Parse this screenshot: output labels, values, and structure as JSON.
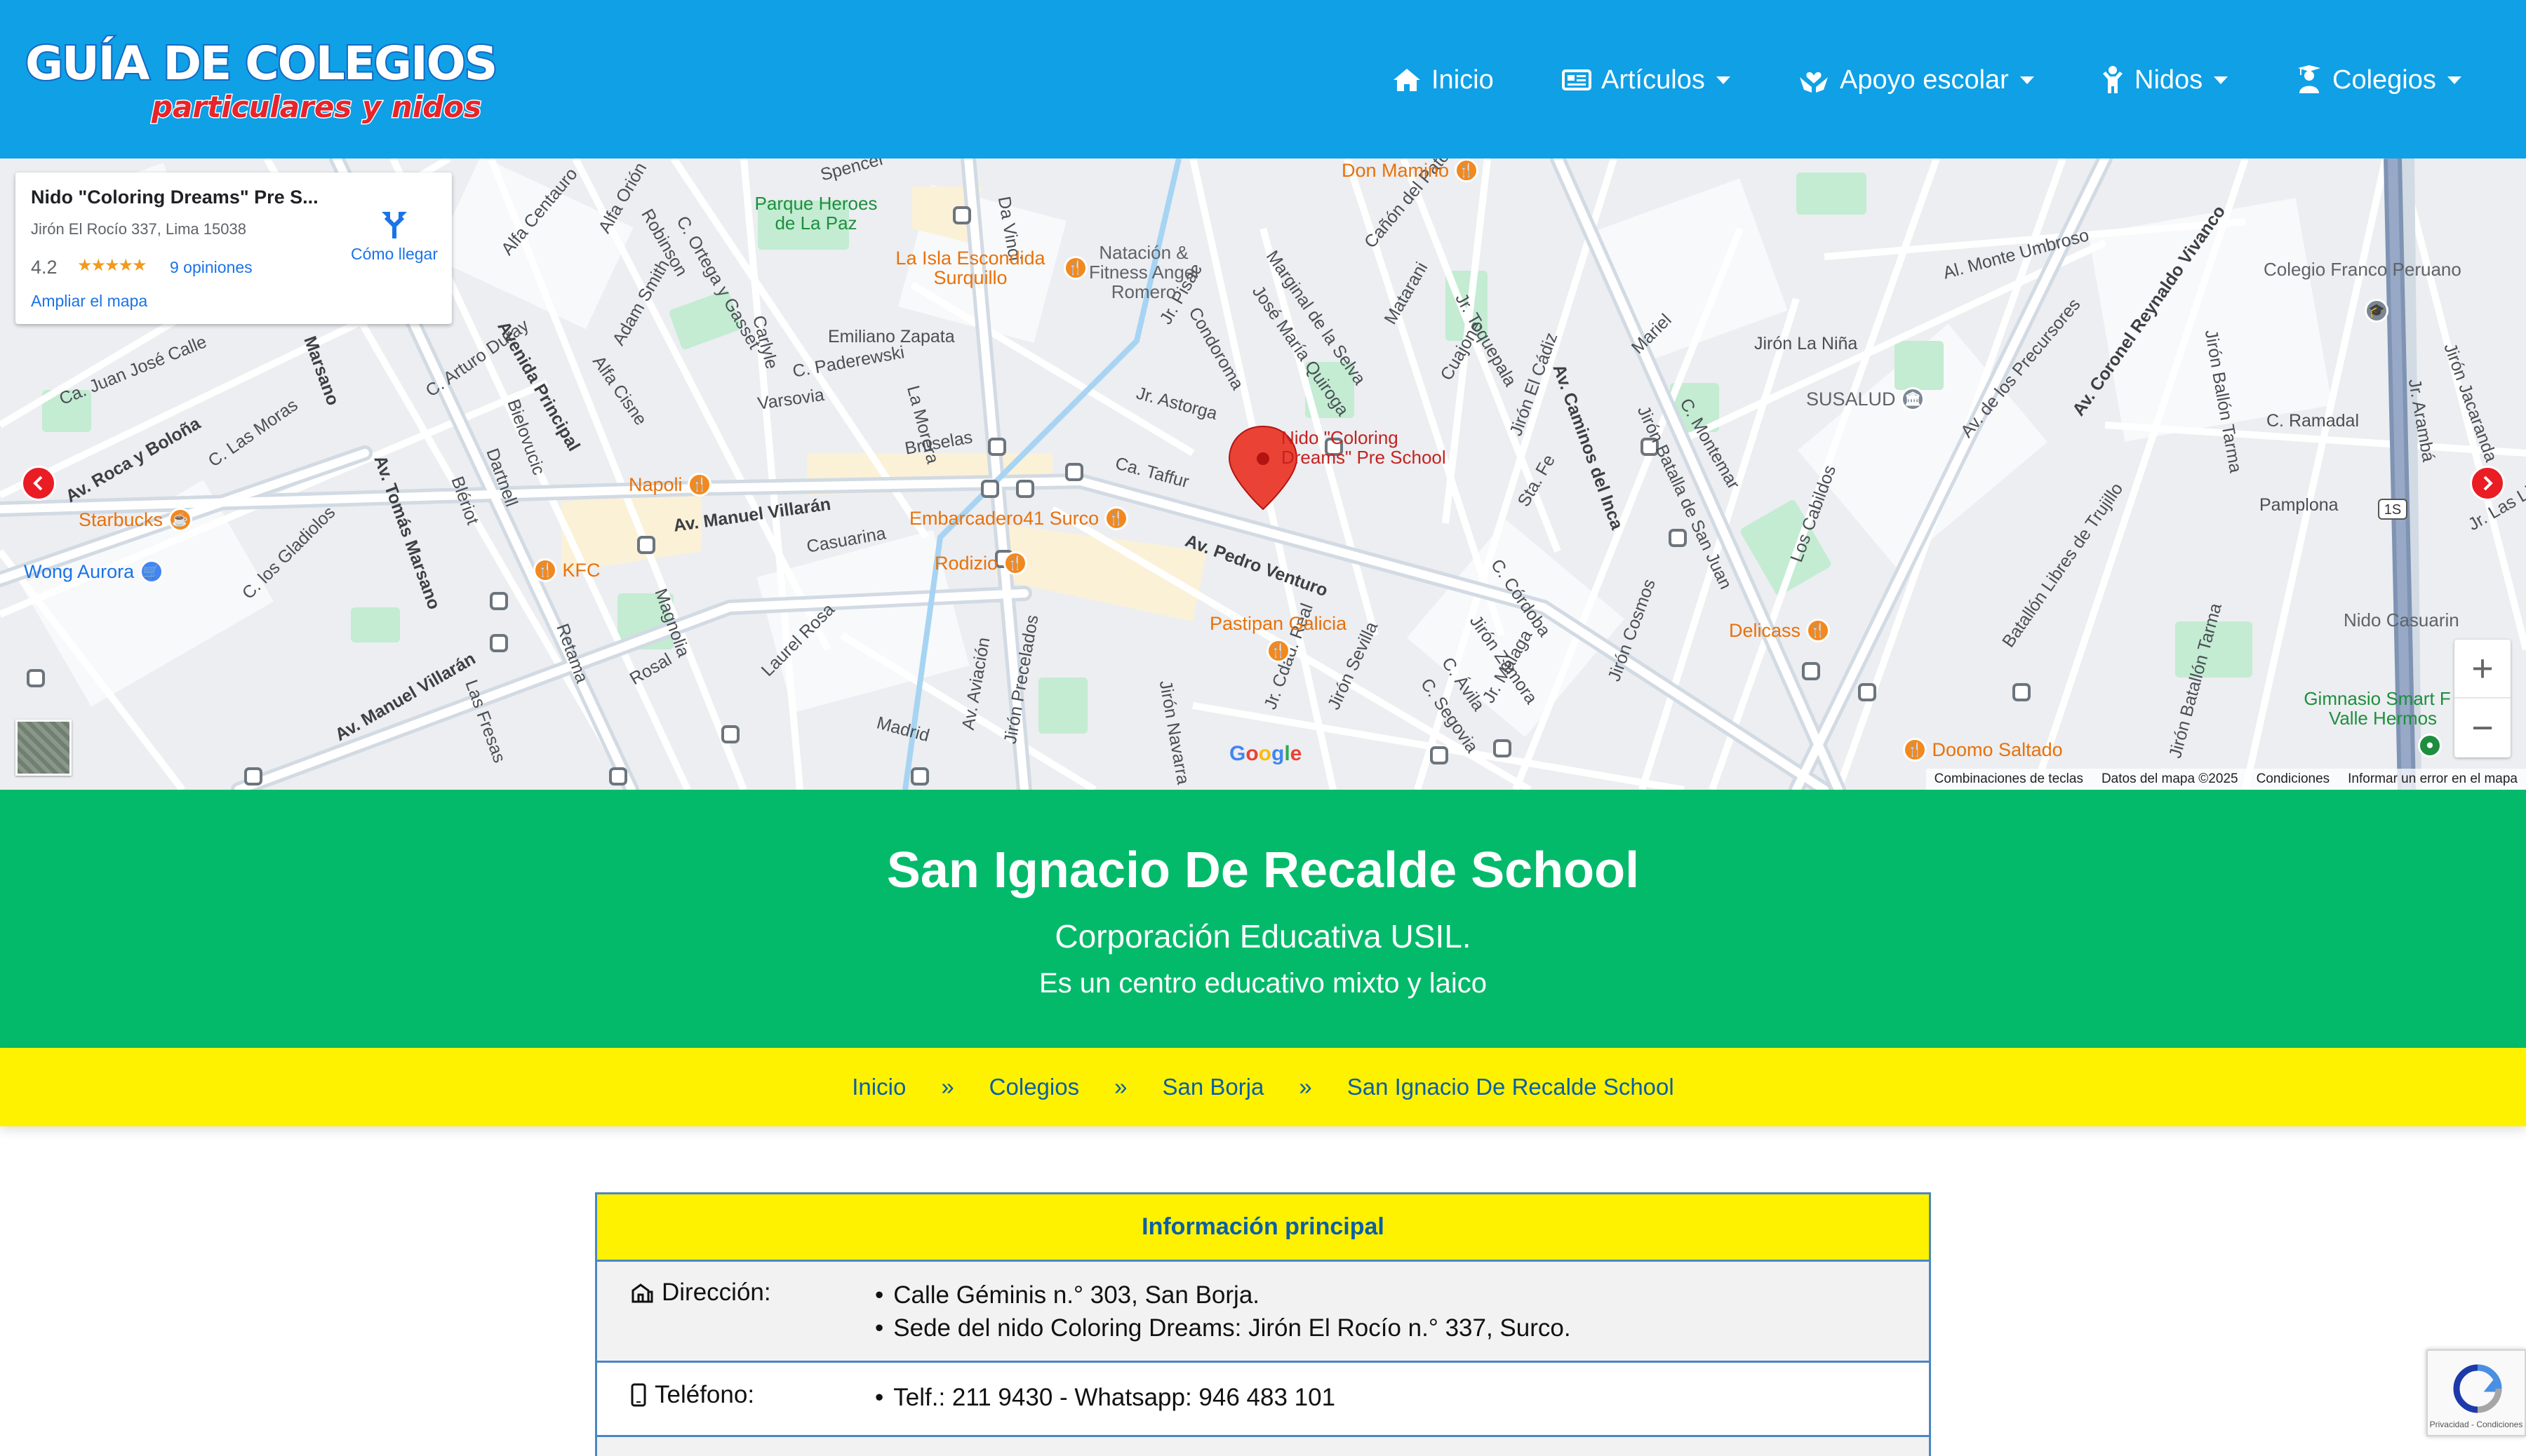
{
  "header": {
    "logo_line1": "GUÍA DE COLEGIOS",
    "logo_line2": "particulares y nidos",
    "nav": [
      {
        "label": "Inicio",
        "icon": "home-icon",
        "has_dropdown": false
      },
      {
        "label": "Artículos",
        "icon": "newspaper-icon",
        "has_dropdown": true
      },
      {
        "label": "Apoyo escolar",
        "icon": "hands-heart-icon",
        "has_dropdown": true
      },
      {
        "label": "Nidos",
        "icon": "child-icon",
        "has_dropdown": true
      },
      {
        "label": "Colegios",
        "icon": "graduate-icon",
        "has_dropdown": true
      }
    ]
  },
  "map": {
    "infocard": {
      "title": "Nido \"Coloring Dreams\" Pre S...",
      "address": "Jirón El Rocío 337, Lima 15038",
      "rating": "4.2",
      "stars": "★★★★★",
      "reviews": "9 opiniones",
      "enlarge": "Ampliar el mapa",
      "directions": "Cómo llegar"
    },
    "marker_label": "Nido \"Coloring Dreams\" Pre School",
    "marker_label_line1": "Nido \"Coloring",
    "marker_label_line2": "Dreams\" Pre School",
    "streets": [
      "Av. Manuel Villarán",
      "Av. Pedro Venturo",
      "Av. Caminos del Inca",
      "Av. Tomás Marsano",
      "Avenida Principal",
      "Av. Roca y Boloña",
      "Av. Coronel Reynaldo Vivanco",
      "Av. de los Precursores",
      "Av. Aviación",
      "Bruselas",
      "Casuarina",
      "Varsovia",
      "Marginal de la Selva",
      "José María Quiroga",
      "Jr. Pisac",
      "Condoroma",
      "Jr. Astorga",
      "Ca. Taffur",
      "Cañón del Pato",
      "Matarani",
      "Jr. Toquepala",
      "Cuajone",
      "Jirón El Cádiz",
      "Sta. Fe",
      "C. Córdoba",
      "Jirón Zamora",
      "C. Ávila",
      "C. Segovia",
      "Jr. Málaga",
      "Jirón Cosmos",
      "Los Cabildos",
      "Batallón Libres de Trujillo",
      "Al. Monte Umbroso",
      "Jirón La Niña",
      "C. Ramadal",
      "Pamplona",
      "Jirón Batalla de San Juan",
      "C. Montemar",
      "Mariel",
      "Jirón Navarra",
      "Jr. Cdad. Real",
      "Jirón Sevilla",
      "Jirón Precelados",
      "Madrid",
      "Laurel Rosa",
      "Rosal",
      "Magnolia",
      "Retama",
      "Las Fresas",
      "C. los Gladiolos",
      "C. Las Moras",
      "Ca. Juan José Calle",
      "Alfa Centauro",
      "Alfa Orión",
      "Robinson",
      "C. Ortega y Gasset",
      "Carlyle",
      "Adam Smith",
      "Alfa Cisne",
      "C. Arturo Duray",
      "Bielovucic",
      "Dartnell",
      "Blériot",
      "Marsano",
      "Emiliano Zapata",
      "C. Paderewski",
      "La Morera",
      "Spencer",
      "Da Vinci",
      "Av. de los Precursores",
      "Jirón Jacaranda",
      "Jr. Arambá",
      "Jr. Las Lima",
      "Jirón Ballón Tarma",
      "Jirón Batallón Tarma"
    ],
    "pois": [
      {
        "name": "Don Mamino",
        "type": "restaurant"
      },
      {
        "name": "La Isla Escondida Surquillo",
        "type": "restaurant"
      },
      {
        "name": "Natación & Fitness Angel Romero",
        "type": "gym"
      },
      {
        "name": "Napoli",
        "type": "restaurant"
      },
      {
        "name": "Starbucks",
        "type": "cafe"
      },
      {
        "name": "Wong Aurora",
        "type": "shopping"
      },
      {
        "name": "KFC",
        "type": "restaurant"
      },
      {
        "name": "Embarcadero41 Surco",
        "type": "restaurant"
      },
      {
        "name": "Rodizio",
        "type": "restaurant"
      },
      {
        "name": "Pastipan Galicia",
        "type": "restaurant"
      },
      {
        "name": "Delicass",
        "type": "restaurant"
      },
      {
        "name": "Doomo Saltado",
        "type": "restaurant"
      },
      {
        "name": "SUSALUD",
        "type": "government"
      },
      {
        "name": "Colegio Franco Peruano",
        "type": "school"
      },
      {
        "name": "Nido Casuarin",
        "type": "school"
      },
      {
        "name": "Gimnasio Smart F - Valle Hermos",
        "type": "gym"
      },
      {
        "name": "Parque Heroes de La Paz",
        "type": "park"
      }
    ],
    "zoom_in": "+",
    "zoom_out": "−",
    "google_logo": "Google",
    "footer": [
      "Combinaciones de teclas",
      "Datos del mapa ©2025",
      "Condiciones",
      "Informar un error en el mapa"
    ],
    "route_shield": "1S"
  },
  "hero": {
    "title": "San Ignacio De Recalde School",
    "subtitle": "Corporación Educativa USIL.",
    "description": "Es un centro educativo mixto y laico"
  },
  "breadcrumb": {
    "items": [
      "Inicio",
      "Colegios",
      "San Borja",
      "San Ignacio De Recalde School"
    ],
    "separator": "»"
  },
  "info": {
    "heading": "Información principal",
    "rows": [
      {
        "label": "Dirección:",
        "icon": "building-icon",
        "values": [
          "Calle Géminis n.° 303, San Borja.",
          "Sede del nido Coloring Dreams: Jirón El Rocío n.° 337, Surco."
        ]
      },
      {
        "label": "Teléfono:",
        "icon": "phone-icon",
        "values": [
          "Telf.: 211 9430 - Whatsapp: 946 483 101"
        ]
      }
    ]
  },
  "recaptcha": {
    "text": "Privacidad - Condiciones"
  },
  "colors": {
    "header": "#0fa0e6",
    "hero": "#03ba6b",
    "breadcrumb": "#fff200",
    "link": "#0b5fa5",
    "arrow": "#ea1c24",
    "poi": "#e8710a"
  }
}
